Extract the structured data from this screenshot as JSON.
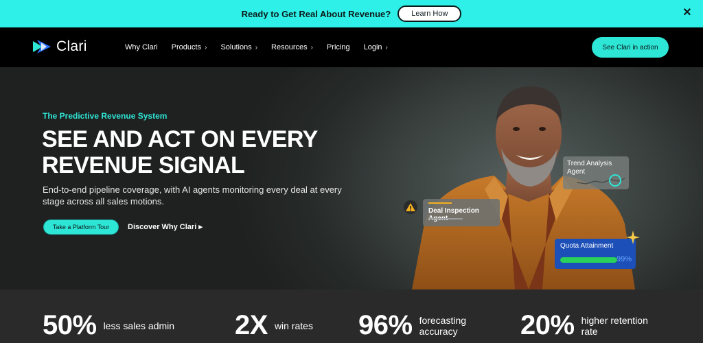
{
  "announcement": {
    "text": "Ready to Get Real About Revenue?",
    "button": "Learn How",
    "close_icon": "close-icon"
  },
  "nav": {
    "logo_text": "Clari",
    "items": [
      {
        "label": "Why Clari",
        "has_chevron": false
      },
      {
        "label": "Products",
        "has_chevron": true
      },
      {
        "label": "Solutions",
        "has_chevron": true
      },
      {
        "label": "Resources",
        "has_chevron": true
      },
      {
        "label": "Pricing",
        "has_chevron": false
      },
      {
        "label": "Login",
        "has_chevron": true
      }
    ],
    "cta": "See Clari in action"
  },
  "hero": {
    "eyebrow": "The Predictive Revenue System",
    "headline": "SEE AND ACT ON EVERY REVENUE SIGNAL",
    "subtext": "End-to-end pipeline coverage, with AI agents monitoring every deal at every stage across all sales motions.",
    "primary_button": "Take a Platform Tour",
    "secondary_link": "Discover Why Clari ▸",
    "cards": {
      "trend": "Trend Analysis Agent",
      "deal": "Deal Inspection Agent",
      "quota_title": "Quota Attainment",
      "quota_pct": "99%",
      "quota_value": 0.99
    }
  },
  "stats": [
    {
      "value": "50%",
      "label": "less sales admin"
    },
    {
      "value": "2X",
      "label": "win rates"
    },
    {
      "value": "96%",
      "label": "forecasting accuracy"
    },
    {
      "value": "20%",
      "label": "higher retention rate"
    }
  ],
  "colors": {
    "accent": "#2ee6d6",
    "announce_bg": "#2ef0e8",
    "nav_bg": "#000000",
    "quota_card": "#1c4fb8",
    "quota_bar": "#29d25a"
  }
}
